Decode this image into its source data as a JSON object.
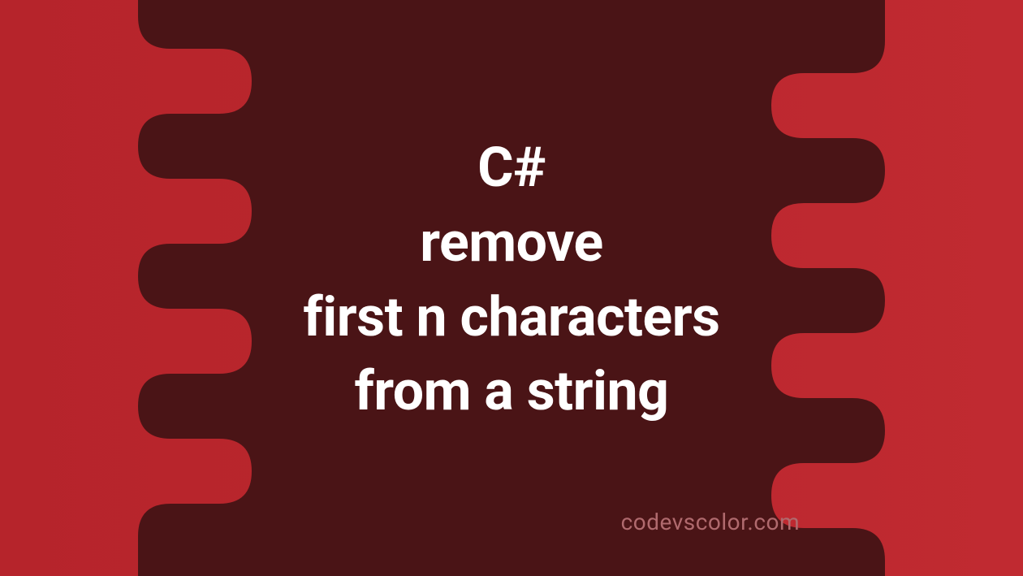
{
  "title": {
    "line1": "C#",
    "line2": "remove",
    "line3": "first n characters",
    "line4": "from a string"
  },
  "watermark": "codevscolor.com",
  "colors": {
    "background_left": "#b6242b",
    "background_right": "#c02a31",
    "blob": "#4a1416",
    "text": "#ffffff",
    "watermark": "#b06a6e"
  }
}
